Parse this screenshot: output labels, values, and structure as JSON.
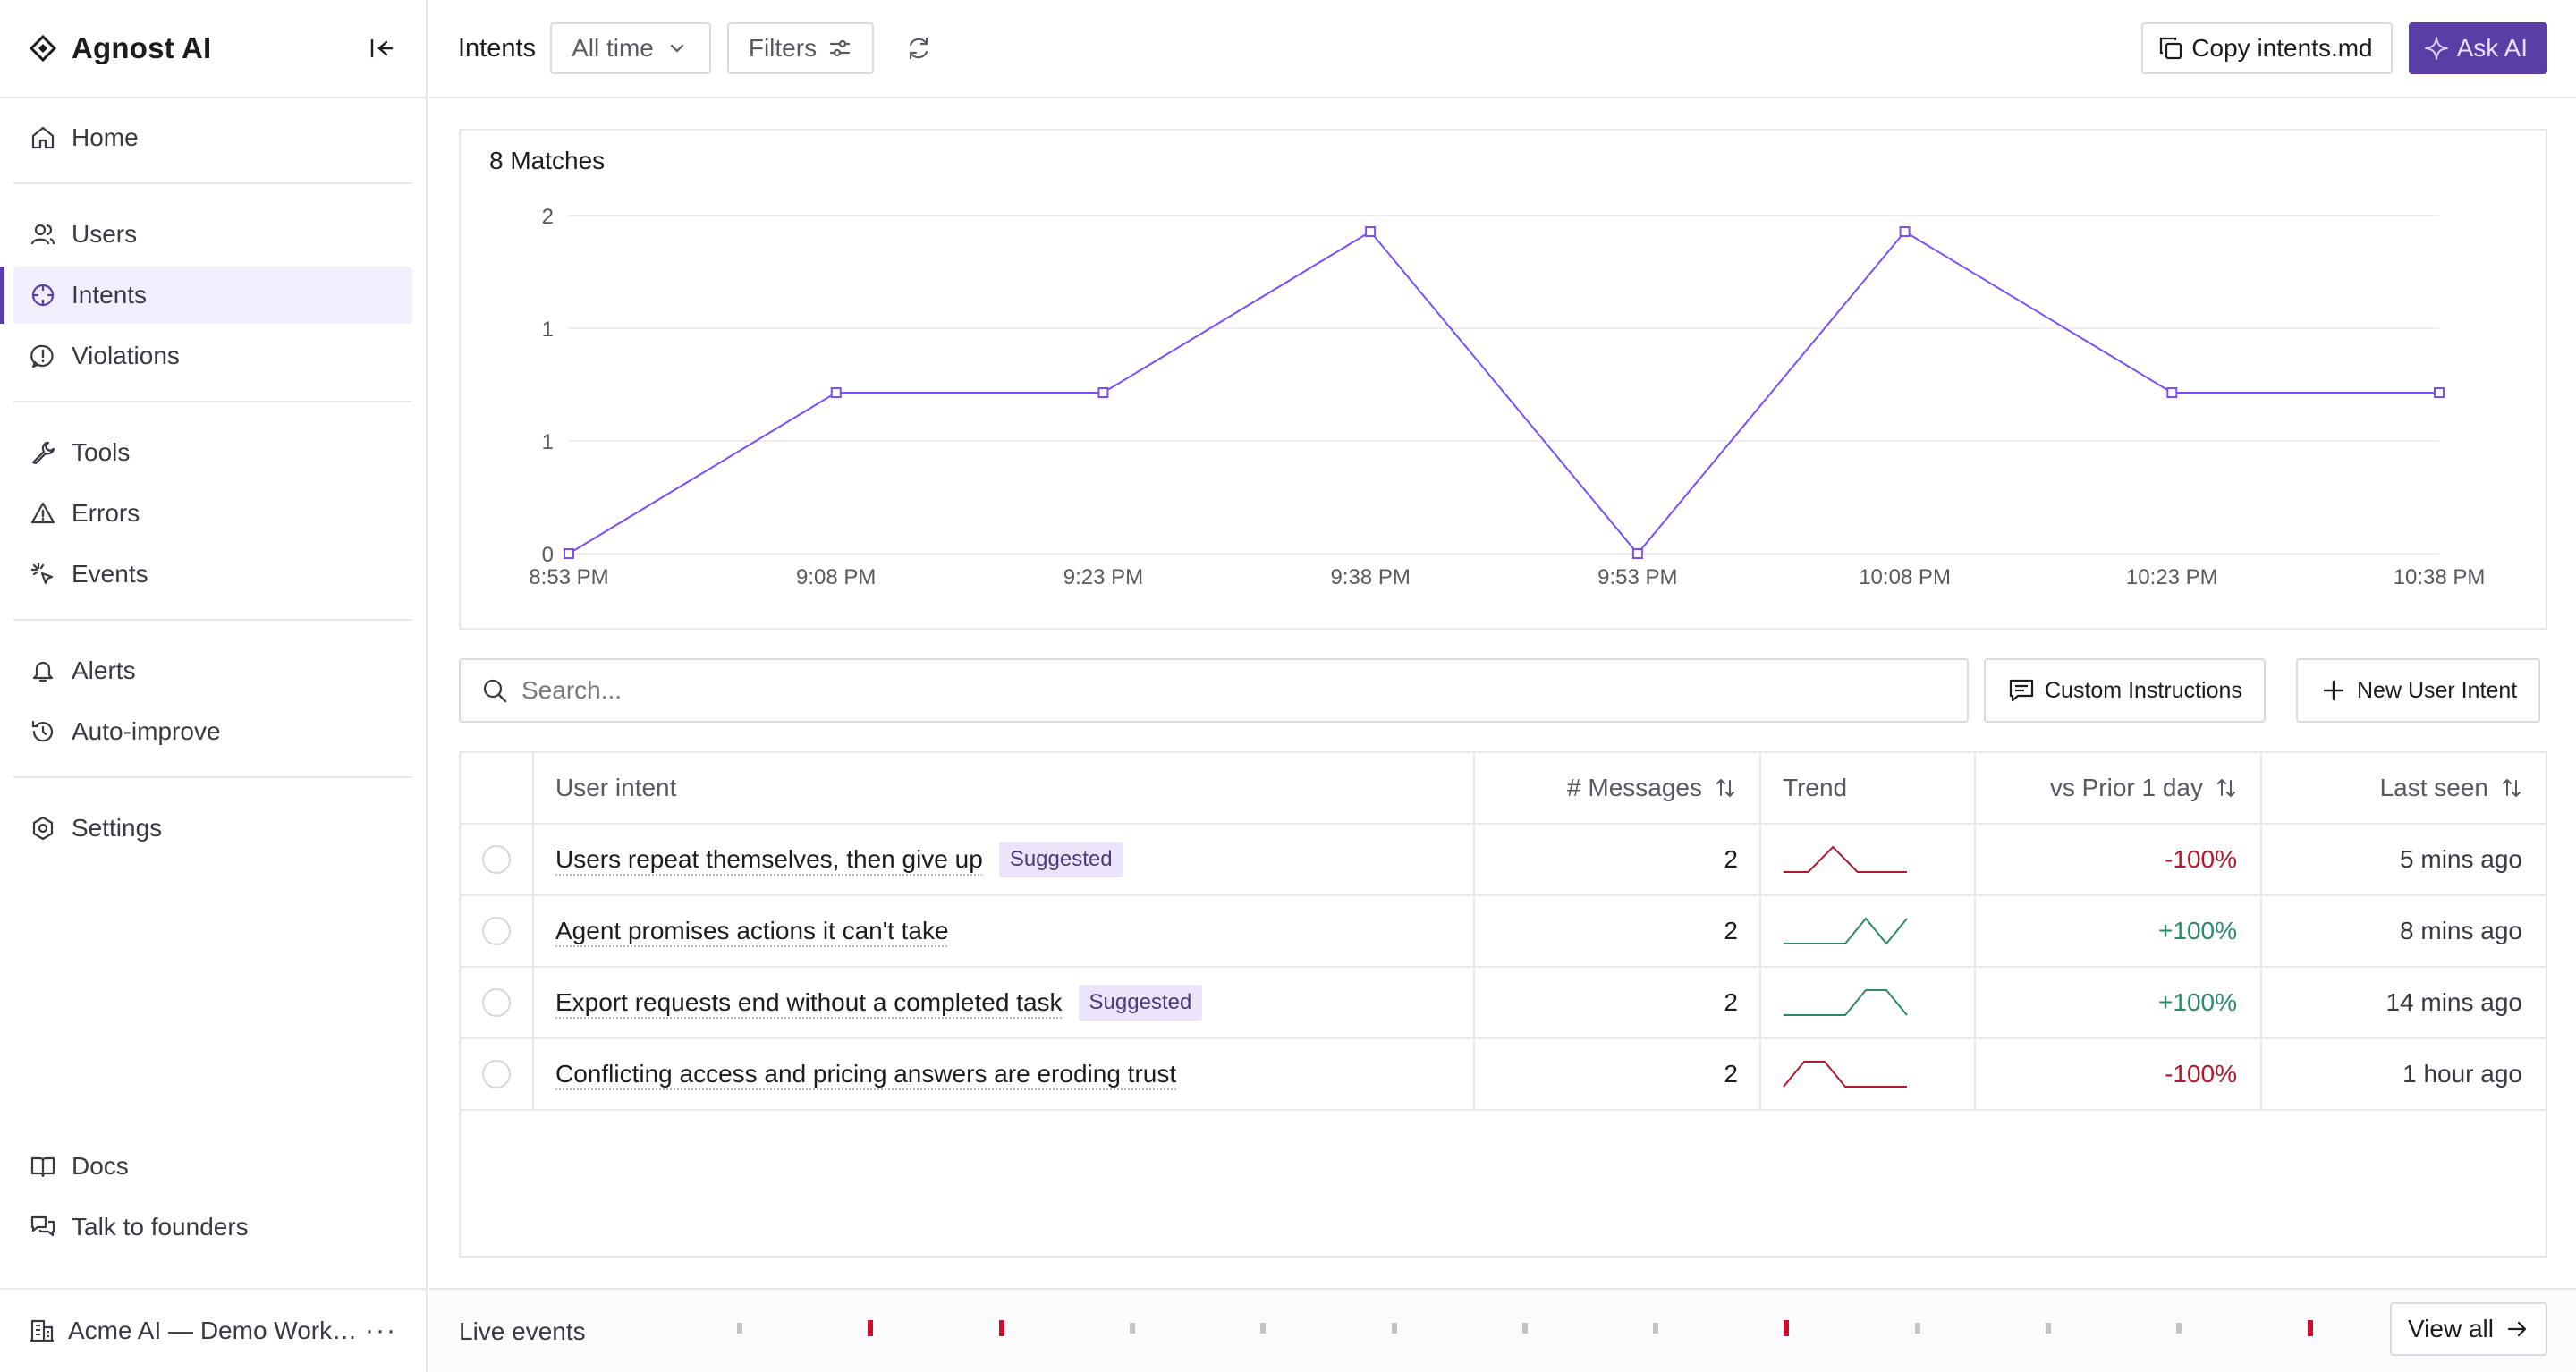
{
  "brand": {
    "name": "Agnost AI",
    "icons": {
      "logo": "diamond-logo-icon",
      "collapse": "collapse-sidebar-icon"
    }
  },
  "nav": {
    "group1": [
      {
        "label": "Home",
        "icon": "home-icon"
      }
    ],
    "group2": [
      {
        "label": "Users",
        "icon": "users-icon"
      },
      {
        "label": "Intents",
        "icon": "crosshair-icon",
        "active": true
      },
      {
        "label": "Violations",
        "icon": "alert-bubble-icon"
      }
    ],
    "group3": [
      {
        "label": "Tools",
        "icon": "wrench-icon"
      },
      {
        "label": "Errors",
        "icon": "warning-icon"
      },
      {
        "label": "Events",
        "icon": "sparkle-cursor-icon"
      }
    ],
    "group4": [
      {
        "label": "Alerts",
        "icon": "bell-icon"
      },
      {
        "label": "Auto-improve",
        "icon": "refresh-clock-icon"
      }
    ],
    "group5": [
      {
        "label": "Settings",
        "icon": "gear-icon"
      }
    ],
    "bottom": [
      {
        "label": "Docs",
        "icon": "book-icon"
      },
      {
        "label": "Talk to founders",
        "icon": "chat-bubbles-icon"
      }
    ]
  },
  "workspace": {
    "name": "Acme AI — Demo Work…",
    "more": "···"
  },
  "header": {
    "title": "Intents",
    "time_filter": "All time",
    "filters_label": "Filters",
    "copy_label": "Copy intents.md",
    "ask_label": "Ask AI"
  },
  "chart": {
    "title": "8 Matches"
  },
  "chart_data": {
    "type": "line",
    "title": "8 Matches",
    "x": [
      "8:53 PM",
      "9:08 PM",
      "9:23 PM",
      "9:38 PM",
      "9:53 PM",
      "10:08 PM",
      "10:23 PM",
      "10:38 PM"
    ],
    "values": [
      0,
      1,
      1,
      2,
      0,
      2,
      1,
      1
    ],
    "y_ticks": [
      {
        "value": 0,
        "label": "0"
      },
      {
        "value": 0.7,
        "label": "1"
      },
      {
        "value": 1.4,
        "label": "1"
      },
      {
        "value": 2.1,
        "label": "2"
      }
    ],
    "ylim": [
      0,
      2.1
    ],
    "grid": true,
    "color": "#7c4dff"
  },
  "search": {
    "placeholder": "Search..."
  },
  "actions": {
    "custom_instructions": "Custom Instructions",
    "new_intent": "New User Intent"
  },
  "table": {
    "headers": {
      "intent": "User intent",
      "messages": "# Messages",
      "trend": "Trend",
      "vs_prior": "vs Prior 1 day",
      "last_seen": "Last seen"
    },
    "rows": [
      {
        "intent": "Users repeat themselves, then give up",
        "badge": "Suggested",
        "messages": "2",
        "change": "-100%",
        "direction": "down",
        "last_seen": "5 mins ago",
        "trend": [
          0,
          0,
          1,
          0,
          0,
          0
        ]
      },
      {
        "intent": "Agent promises actions it can't take",
        "badge": "",
        "messages": "2",
        "change": "+100%",
        "direction": "up",
        "last_seen": "8 mins ago",
        "trend": [
          0,
          0,
          0,
          0,
          1,
          0,
          1
        ]
      },
      {
        "intent": "Export requests end without a completed task",
        "badge": "Suggested",
        "messages": "2",
        "change": "+100%",
        "direction": "up",
        "last_seen": "14 mins ago",
        "trend": [
          0,
          0,
          0,
          0,
          1,
          1,
          0
        ]
      },
      {
        "intent": "Conflicting access and pricing answers are eroding trust",
        "badge": "",
        "messages": "2",
        "change": "-100%",
        "direction": "down",
        "last_seen": "1 hour ago",
        "trend": [
          0,
          1,
          1,
          0,
          0,
          0,
          0
        ]
      }
    ]
  },
  "live": {
    "label": "Live events",
    "events": [
      "neutral",
      "error",
      "error",
      "neutral",
      "neutral",
      "neutral",
      "neutral",
      "neutral",
      "error",
      "neutral",
      "neutral",
      "neutral",
      "error"
    ],
    "view_all": "View all"
  },
  "colors": {
    "accent": "#5b3ea5",
    "line": "#7c4dff",
    "down": "#b2182b",
    "up": "#2c8a6a",
    "event_error": "#c8102e",
    "event_neutral": "#c4c2c8"
  }
}
